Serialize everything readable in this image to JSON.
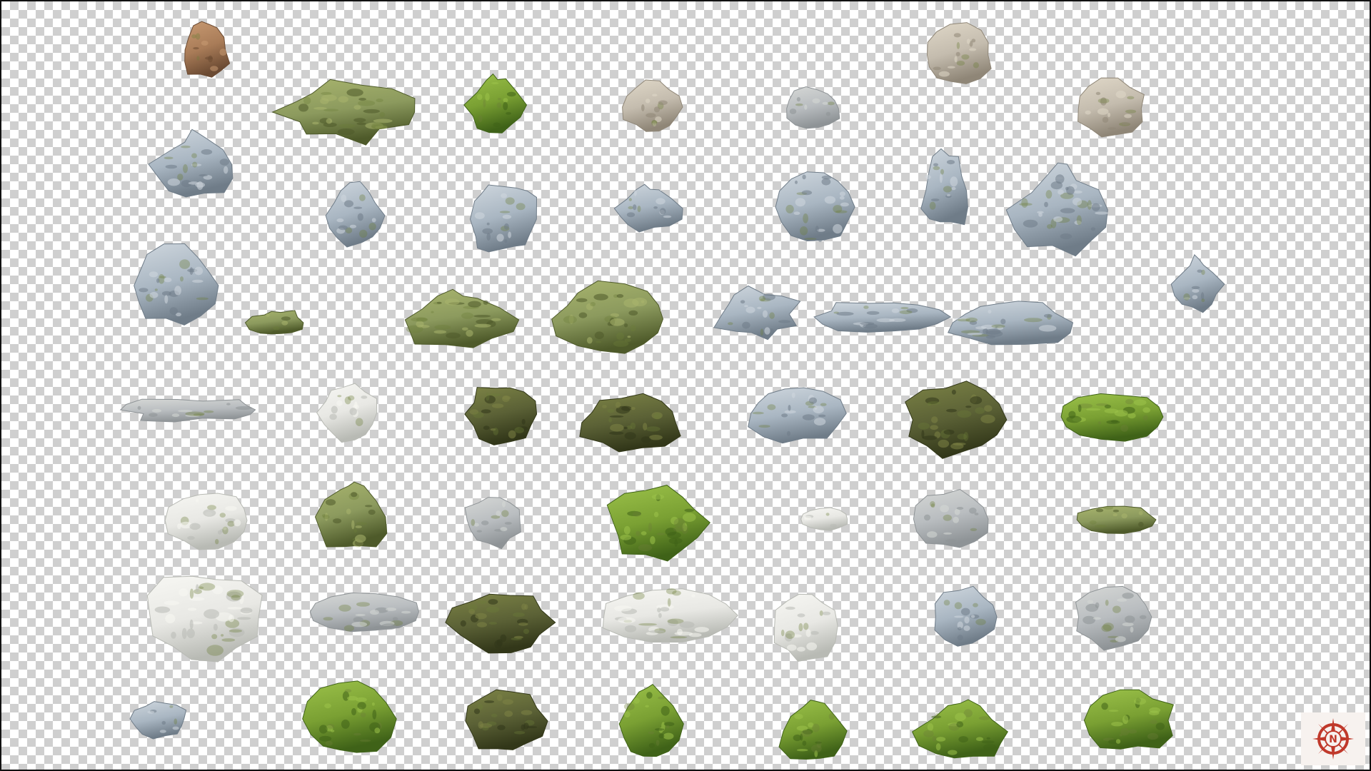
{
  "canvas": {
    "background": "transparency-checkerboard",
    "checker_light": "#ffffff",
    "checker_dark": "#cfcfcf",
    "border_color": "#111111"
  },
  "logo": {
    "icon": "compass-logo-icon",
    "letter": "N",
    "color": "#c0392b"
  },
  "palette": {
    "grey": [
      "#b9bdc0",
      "#8e9396",
      "#d6d8d6"
    ],
    "grey_blue": [
      "#a9b6c2",
      "#6f7c88",
      "#cfd7de"
    ],
    "tan": [
      "#c4bcae",
      "#8f8677",
      "#e0d8c8"
    ],
    "white": [
      "#e8e8e4",
      "#b8bab4",
      "#f7f7f3"
    ],
    "moss": [
      "#8c9a5e",
      "#4e5a2a",
      "#a9b56e"
    ],
    "dark_moss": [
      "#5b6136",
      "#323719",
      "#7d8446"
    ],
    "moss_green": [
      "#7aa033",
      "#3f6218",
      "#9cc24a"
    ],
    "brown": [
      "#a97c58",
      "#6b4a32",
      "#c89a72"
    ]
  },
  "rocks": [
    {
      "name": "rock-01",
      "tone": "brown",
      "shape": "spire"
    },
    {
      "name": "rock-02",
      "tone": "tan",
      "shape": "boulder"
    },
    {
      "name": "rock-03",
      "tone": "moss",
      "shape": "ridge"
    },
    {
      "name": "rock-04",
      "tone": "moss_green",
      "shape": "peak"
    },
    {
      "name": "rock-05",
      "tone": "tan",
      "shape": "boulder"
    },
    {
      "name": "rock-06",
      "tone": "grey",
      "shape": "boulder"
    },
    {
      "name": "rock-07",
      "tone": "tan",
      "shape": "boulder"
    },
    {
      "name": "rock-08",
      "tone": "grey_blue",
      "shape": "peak"
    },
    {
      "name": "rock-09",
      "tone": "grey_blue",
      "shape": "spire"
    },
    {
      "name": "rock-10",
      "tone": "grey_blue",
      "shape": "block"
    },
    {
      "name": "rock-11",
      "tone": "grey_blue",
      "shape": "peak"
    },
    {
      "name": "rock-12",
      "tone": "grey_blue",
      "shape": "slab"
    },
    {
      "name": "rock-13",
      "tone": "grey_blue",
      "shape": "spire"
    },
    {
      "name": "rock-14",
      "tone": "grey_blue",
      "shape": "peak"
    },
    {
      "name": "rock-15",
      "tone": "grey_blue",
      "shape": "peak"
    },
    {
      "name": "rock-16",
      "tone": "grey_blue",
      "shape": "boulder"
    },
    {
      "name": "rock-17",
      "tone": "moss",
      "shape": "ridge"
    },
    {
      "name": "rock-18",
      "tone": "moss",
      "shape": "peak"
    },
    {
      "name": "rock-19",
      "tone": "moss",
      "shape": "boulder"
    },
    {
      "name": "rock-20",
      "tone": "grey_blue",
      "shape": "ridge"
    },
    {
      "name": "rock-21",
      "tone": "grey_blue",
      "shape": "ridge"
    },
    {
      "name": "rock-22",
      "tone": "grey_blue",
      "shape": "spire"
    },
    {
      "name": "rock-23",
      "tone": "grey",
      "shape": "ridge"
    },
    {
      "name": "rock-24",
      "tone": "white",
      "shape": "boulder"
    },
    {
      "name": "rock-25",
      "tone": "dark_moss",
      "shape": "boulder"
    },
    {
      "name": "rock-26",
      "tone": "dark_moss",
      "shape": "boulder"
    },
    {
      "name": "rock-27",
      "tone": "grey_blue",
      "shape": "boulder"
    },
    {
      "name": "rock-28",
      "tone": "dark_moss",
      "shape": "boulder"
    },
    {
      "name": "rock-29",
      "tone": "moss_green",
      "shape": "slab"
    },
    {
      "name": "rock-30",
      "tone": "white",
      "shape": "slab"
    },
    {
      "name": "rock-31",
      "tone": "moss",
      "shape": "peak"
    },
    {
      "name": "rock-32",
      "tone": "grey",
      "shape": "boulder"
    },
    {
      "name": "rock-33",
      "tone": "moss_green",
      "shape": "boulder"
    },
    {
      "name": "rock-34",
      "tone": "white",
      "shape": "slab"
    },
    {
      "name": "rock-35",
      "tone": "grey",
      "shape": "boulder"
    },
    {
      "name": "rock-36",
      "tone": "moss",
      "shape": "slab"
    },
    {
      "name": "rock-37",
      "tone": "white",
      "shape": "boulder"
    },
    {
      "name": "rock-38",
      "tone": "grey",
      "shape": "slab"
    },
    {
      "name": "rock-39",
      "tone": "dark_moss",
      "shape": "boulder"
    },
    {
      "name": "rock-40",
      "tone": "white",
      "shape": "slab"
    },
    {
      "name": "rock-41",
      "tone": "white",
      "shape": "boulder"
    },
    {
      "name": "rock-42",
      "tone": "grey_blue",
      "shape": "boulder"
    },
    {
      "name": "rock-43",
      "tone": "grey",
      "shape": "boulder"
    },
    {
      "name": "rock-44",
      "tone": "grey_blue",
      "shape": "boulder"
    },
    {
      "name": "rock-45",
      "tone": "moss_green",
      "shape": "boulder"
    },
    {
      "name": "rock-46",
      "tone": "dark_moss",
      "shape": "boulder"
    },
    {
      "name": "rock-47",
      "tone": "moss_green",
      "shape": "peak"
    },
    {
      "name": "rock-48",
      "tone": "moss_green",
      "shape": "peak"
    },
    {
      "name": "rock-49",
      "tone": "moss_green",
      "shape": "peak"
    },
    {
      "name": "rock-50",
      "tone": "moss_green",
      "shape": "boulder"
    },
    {
      "name": "rock-51",
      "tone": "white",
      "shape": "boulder"
    }
  ]
}
